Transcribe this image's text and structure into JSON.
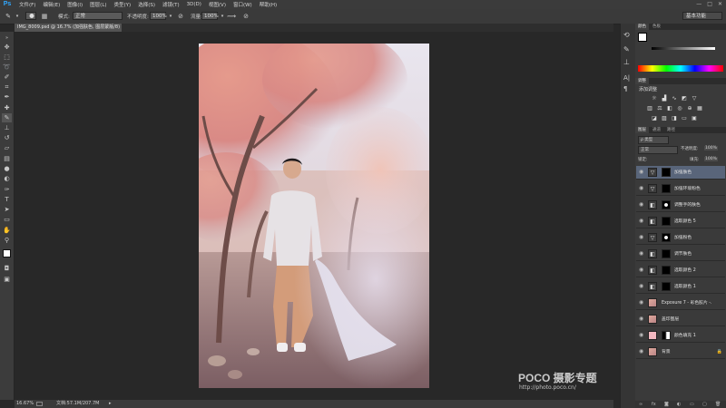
{
  "app": {
    "logo": "Ps"
  },
  "menu": [
    "文件(F)",
    "编辑(E)",
    "图像(I)",
    "图层(L)",
    "类型(Y)",
    "选择(S)",
    "滤镜(T)",
    "3D(D)",
    "视图(V)",
    "窗口(W)",
    "帮助(H)"
  ],
  "window_controls": {
    "minimize": "—",
    "maximize": "□",
    "close": "✕"
  },
  "options": {
    "mode_label": "模式:",
    "mode_value": "正常",
    "opacity_label": "不透明度:",
    "opacity_value": "100%",
    "flow_label": "流量:",
    "flow_value": "100%",
    "workspace": "基本功能"
  },
  "document": {
    "tab_title": "IMG_8009.psd @ 16.7% (加强肤色, 图层蒙版/8)",
    "tab_close": "×",
    "zoom": "16.67%",
    "doc_info": "文档:57.1M/207.7M"
  },
  "watermark": {
    "brand": "POCO 摄影专题",
    "url": "http://photo.poco.cn/"
  },
  "colors": {
    "accent": "#31a8ff",
    "selected_layer": "#59657a",
    "panel_bg": "#3a3a3a",
    "canvas_bg": "#282828"
  },
  "tools": [
    "move-icon",
    "marquee-icon",
    "lasso-icon",
    "quick-select-icon",
    "crop-icon",
    "eyedropper-icon",
    "healing-icon",
    "brush-icon",
    "stamp-icon",
    "history-brush-icon",
    "eraser-icon",
    "gradient-icon",
    "blur-icon",
    "dodge-icon",
    "pen-icon",
    "type-icon",
    "path-select-icon",
    "shape-icon",
    "hand-icon",
    "zoom-icon"
  ],
  "panels": {
    "color_tabs": [
      "颜色",
      "色板"
    ],
    "adjust_tabs": [
      "调整"
    ],
    "adjust_title": "添加调整",
    "layers_tabs": [
      "图层",
      "通道",
      "路径"
    ],
    "kind_label": "ρ 类型",
    "blend_mode": "正常",
    "opacity_label": "不透明度:",
    "opacity_value": "100%",
    "lock_label": "锁定:",
    "fill_label": "填充:",
    "fill_value": "100%"
  },
  "layers": [
    {
      "name": "加强肤色",
      "thumb": "curves",
      "selected": true
    },
    {
      "name": "加强环境粉色",
      "thumb": "curves",
      "selected": false
    },
    {
      "name": "调整手的肤色",
      "thumb": "levels",
      "selected": false
    },
    {
      "name": "选取颜色 5",
      "thumb": "levels",
      "selected": false
    },
    {
      "name": "加强粉色",
      "thumb": "curves",
      "selected": false
    },
    {
      "name": "调节肤色",
      "thumb": "levels",
      "selected": false
    },
    {
      "name": "选取颜色 2",
      "thumb": "levels",
      "selected": false
    },
    {
      "name": "选取颜色 1",
      "thumb": "levels",
      "selected": false
    },
    {
      "name": "Exposure 7 - 彩色胶片 -...",
      "thumb": "photo",
      "selected": false
    },
    {
      "name": "盖印图层",
      "thumb": "photo",
      "selected": false
    },
    {
      "name": "颜色填充 1",
      "thumb": "pink",
      "selected": false
    },
    {
      "name": "背景",
      "thumb": "photo",
      "selected": false
    }
  ]
}
